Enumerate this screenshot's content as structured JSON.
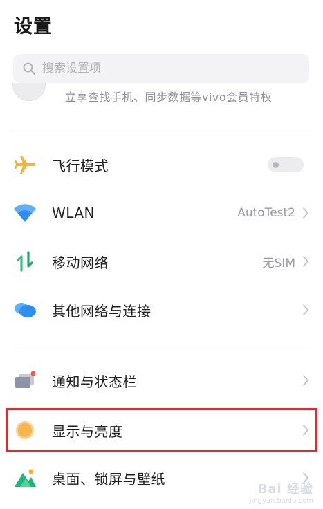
{
  "header": {
    "title": "设置"
  },
  "search": {
    "placeholder": "搜索设置项"
  },
  "account": {
    "subtitle": "立享查找手机、同步数据等vivo会员特权"
  },
  "items": [
    {
      "label": "飞行模式",
      "icon": "airplane-icon",
      "control": "toggle",
      "toggle_on": false
    },
    {
      "label": "WLAN",
      "icon": "wifi-icon",
      "value": "AutoTest2"
    },
    {
      "label": "移动网络",
      "icon": "mobile-data-icon",
      "value": "无SIM"
    },
    {
      "label": "其他网络与连接",
      "icon": "cloud-link-icon"
    },
    {
      "label": "通知与状态栏",
      "icon": "notification-icon"
    },
    {
      "label": "显示与亮度",
      "icon": "sun-icon",
      "highlighted": true
    },
    {
      "label": "桌面、锁屏与壁纸",
      "icon": "wallpaper-icon"
    }
  ],
  "watermark": {
    "main": "Bai 经验",
    "sub": "jingyan.baidu.com"
  },
  "colors": {
    "highlight_border": "#e8262a",
    "airplane": "#f5b33a",
    "wifi": "#2f8ef0",
    "sun": "#f7b54a"
  }
}
